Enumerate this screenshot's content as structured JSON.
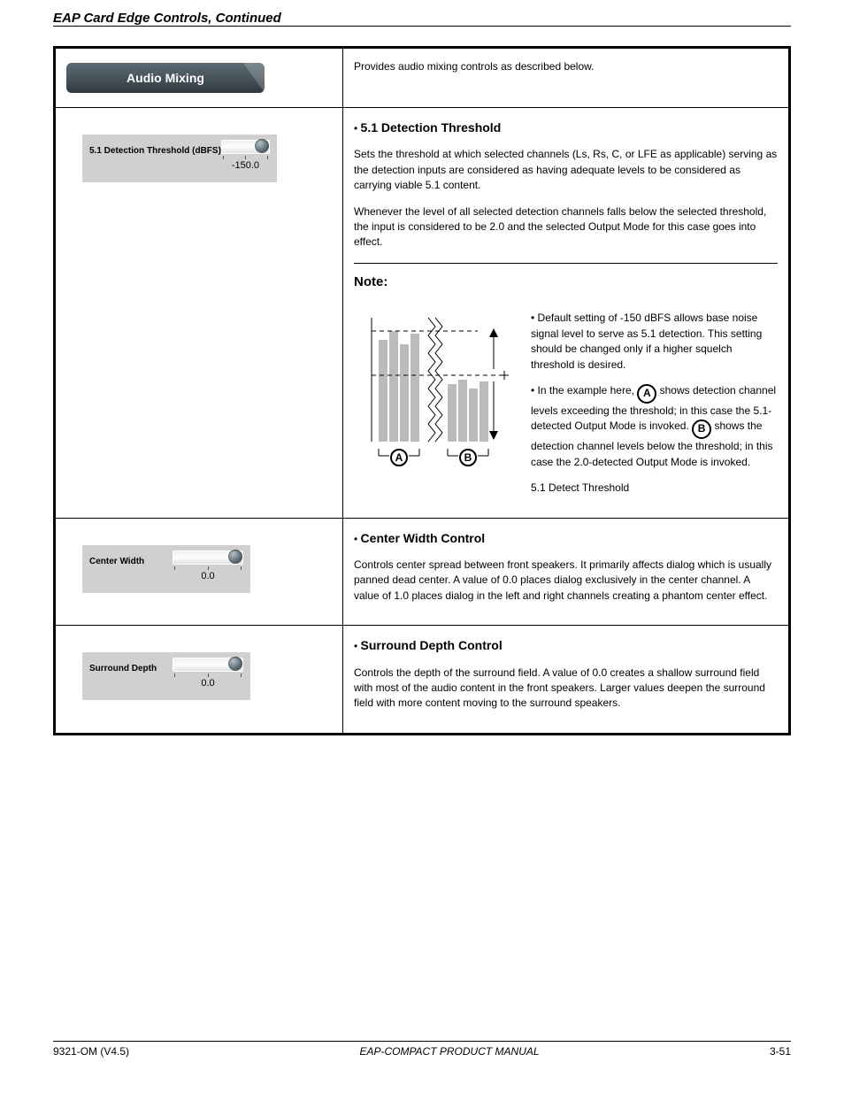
{
  "header": {
    "title": "EAP Card Edge Controls, Continued"
  },
  "table": {
    "row0": {
      "pill": "Audio Mixing",
      "right": "Provides audio mixing controls as described below."
    },
    "row1": {
      "slider": {
        "label": "5.1 Detection Threshold (dBFS)",
        "value": "-150.0"
      },
      "right": {
        "title": "5.1 Detection Threshold",
        "p1": "Sets the threshold at which selected channels (Ls, Rs, C, or LFE as applicable) serving as the detection inputs are considered as having adequate levels to be considered as carrying viable 5.1 content.",
        "p2": "Whenever the level of all selected detection channels falls below the selected threshold, the input is considered to be 2.0 and the selected Output Mode for this case goes into effect.",
        "note_label": "Note:",
        "note1_a": "Default setting of -150 dBFS allows base noise signal level to serve as 5.1 detection. This setting should be changed only if a higher squelch threshold is desired.",
        "note1_b": "In the example here, ",
        "note1_c": " shows detection channel levels exceeding the threshold; in this case the 5.1-detected Output Mode is invoked. ",
        "note1_d": " shows the detection channel levels below the threshold; in this case the 2.0-detected Output Mode is invoked."
      }
    },
    "row2": {
      "slider": {
        "label": "Center Width",
        "value": "0.0"
      },
      "right": {
        "title": "Center Width Control",
        "body": "Controls center spread between front speakers. It primarily affects dialog which is usually panned dead center. A value of 0.0 places dialog exclusively in the center channel. A value of 1.0 places dialog in the left and right channels creating a phantom center effect."
      }
    },
    "row3": {
      "slider": {
        "label": "Surround Depth",
        "value": "0.0"
      },
      "right": {
        "title": "Surround Depth Control",
        "body": "Controls the depth of the surround field. A value of 0.0 creates a shallow surround field with most of the audio content in the front speakers. Larger values deepen the surround field with more content moving to the surround speakers."
      }
    }
  },
  "graphic": {
    "labels": {
      "A": "A",
      "B": "B",
      "threshold": "5.1 Detect Threshold"
    }
  },
  "footer": {
    "left": "9321-OM (V4.5)",
    "center": "EAP-COMPACT PRODUCT MANUAL",
    "right": "3-51"
  }
}
